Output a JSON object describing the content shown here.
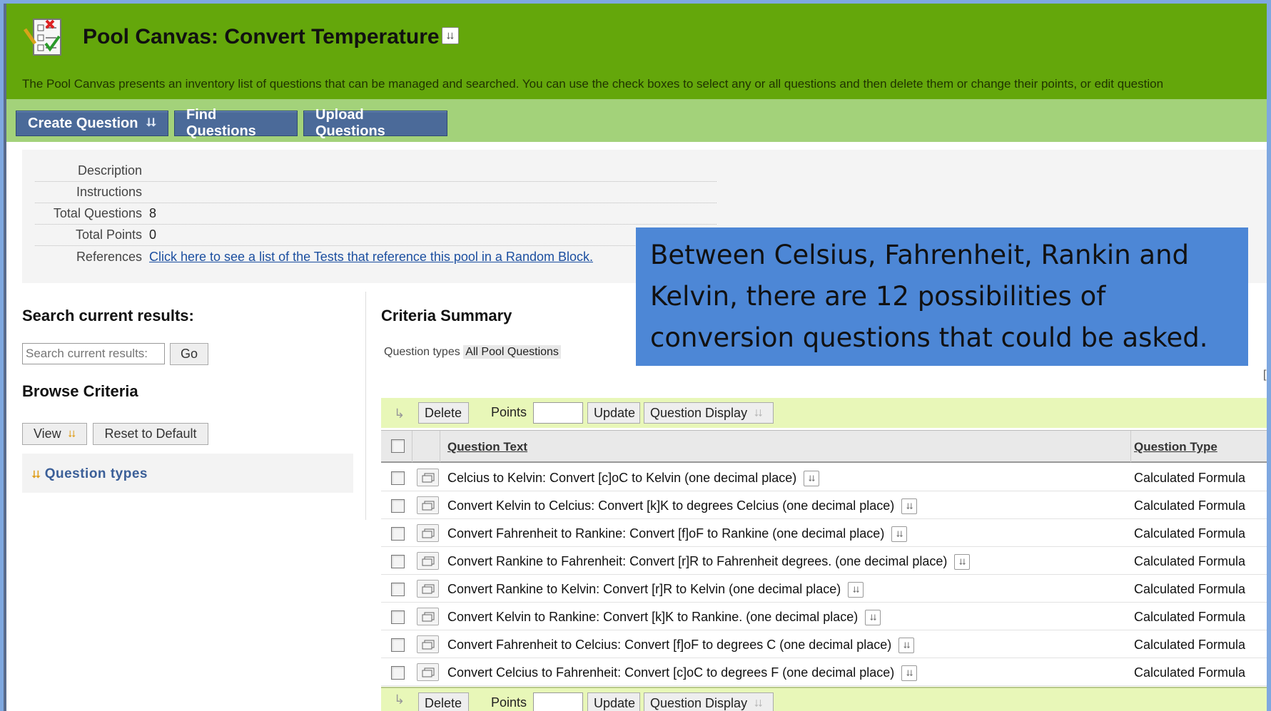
{
  "header": {
    "title": "Pool Canvas: Convert Temperature",
    "description": "The Pool Canvas presents an inventory list of questions that can be managed and searched. You can use the check boxes to select any or all questions and then delete them or change their points, or edit question"
  },
  "actions": {
    "create_question": "Create Question",
    "find_questions": "Find Questions",
    "upload_questions": "Upload Questions"
  },
  "info": {
    "description_label": "Description",
    "instructions_label": "Instructions",
    "total_questions_label": "Total Questions",
    "total_questions_value": "8",
    "total_points_label": "Total Points",
    "total_points_value": "0",
    "references_label": "References",
    "references_link": "Click here to see a list of the Tests that reference this pool in a Random Block."
  },
  "search": {
    "title": "Search current results:",
    "placeholder": "Search current results:",
    "go_label": "Go"
  },
  "browse": {
    "title": "Browse Criteria",
    "view_label": "View",
    "reset_label": "Reset to Default",
    "question_types_label": "Question types"
  },
  "criteria": {
    "title": "Criteria Summary",
    "question_types_label": "Question types",
    "question_types_value": "All Pool Questions"
  },
  "callout": {
    "text": "Between Celsius, Fahrenheit, Rankin and Kelvin, there are 12 possibilities of conversion questions that could be asked."
  },
  "toolbar": {
    "delete_label": "Delete",
    "points_label": "Points",
    "update_label": "Update",
    "question_display_label": "Question Display"
  },
  "table": {
    "columns": [
      "Question Text",
      "Question Type"
    ],
    "rows": [
      {
        "text": "Celcius to Kelvin: Convert [c]oC to Kelvin (one decimal place)",
        "type": "Calculated Formula"
      },
      {
        "text": "Convert Kelvin to Celcius: Convert [k]K to degrees Celcius (one decimal  place)",
        "type": "Calculated Formula"
      },
      {
        "text": "Convert Fahrenheit to Rankine: Convert [f]oF to Rankine (one decimal place)",
        "type": "Calculated Formula"
      },
      {
        "text": "Convert Rankine to Fahrenheit: Convert [r]R to Fahrenheit degrees. (one decimal place)",
        "type": "Calculated Formula"
      },
      {
        "text": "Convert Rankine to Kelvin: Convert [r]R to Kelvin (one decimal place)",
        "type": "Calculated Formula"
      },
      {
        "text": "Convert Kelvin to Rankine: Convert [k]K to Rankine. (one decimal place)",
        "type": "Calculated Formula"
      },
      {
        "text": "Convert Fahrenheit to Celcius: Convert [f]oF to degrees C (one decimal place)",
        "type": "Calculated Formula"
      },
      {
        "text": "Convert Celcius to Fahrenheit: Convert [c]oC to degrees F (one decimal place)",
        "type": "Calculated Formula"
      }
    ]
  },
  "icons": {
    "menu": "chevron-down-icon",
    "pool": "checklist-icon",
    "question": "question-preview-icon"
  },
  "colors": {
    "header_bg": "#64a70b",
    "actionbar_bg": "#a3d27a",
    "button_bg": "#4b6a99",
    "callout_bg": "#4d87d6",
    "toolbar_bg": "#e8f7b8"
  }
}
